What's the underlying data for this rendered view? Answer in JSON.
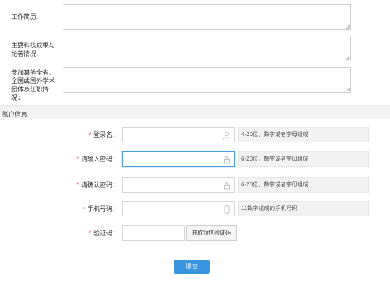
{
  "profile": {
    "work_history_label": "工作简历：",
    "achievements_label": "主要科技成果与论著情况：",
    "memberships_label": "参加其他全省、全国或国外学术团体及任职情况："
  },
  "account": {
    "section_title": "账户信息",
    "required_mark": "*",
    "login_name": {
      "label": "登录名：",
      "hint": "4-20位，数字或者字母组成",
      "icon": "user-icon"
    },
    "password": {
      "label": "请输入密码：",
      "hint": "6-20位，数字或者字母组成",
      "icon": "lock-icon"
    },
    "confirm_password": {
      "label": "请确认密码：",
      "hint": "6-20位，数字或者字母组成",
      "icon": "lock-icon"
    },
    "phone": {
      "label": "手机号码：",
      "hint": "11数字组成的手机号码",
      "icon": "phone-icon"
    },
    "verification": {
      "label": "验证码：",
      "button_label": "获取短信验证码"
    }
  },
  "submit_label": "提交",
  "colors": {
    "accent": "#3a95e0",
    "required": "#e4393c",
    "focus_border": "#4a9fe0"
  }
}
